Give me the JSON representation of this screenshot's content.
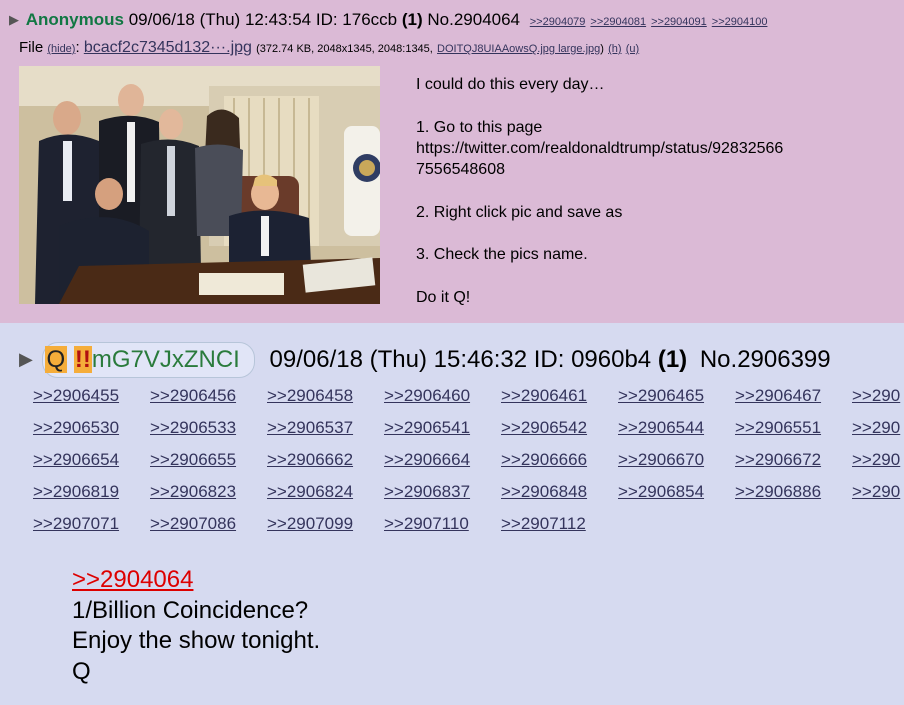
{
  "post1": {
    "name": "Anonymous",
    "datetime": "09/06/18 (Thu) 12:43:54",
    "id_label": "ID: 176ccb",
    "count": "(1)",
    "number": "No.2904064",
    "backlinks": [
      ">>2904079",
      ">>2904081",
      ">>2904091",
      ">>2904100"
    ],
    "file_label": "File",
    "hide_label": "(hide)",
    "filename": "bcacf2c7345d132···.jpg",
    "file_meta_open": "(372.74 KB, 2048x1345, 2048:1345,",
    "original_filename": "DOITQJ8UIAAowsQ.jpg large.jpg",
    "file_meta_close": ")",
    "h_label": "(h)",
    "u_label": "(u)",
    "message": {
      "line1": "I could do this every day…",
      "line2": "1. Go to this page",
      "line3": "https://twitter.com/realdonaldtrump/status/92832566",
      "line4": "7556548608",
      "line5": "2. Right click pic and save as",
      "line6": "3. Check the pics name.",
      "line7": "Do it Q!"
    }
  },
  "post2": {
    "name": "Q",
    "trip_mark": "!!",
    "tripcode": "mG7VJxZNCI",
    "datetime": "09/06/18 (Thu) 15:46:32",
    "id_label": "ID: 0960b4",
    "count": "(1)",
    "number": "No.2906399",
    "backlinks": [
      ">>2906455",
      ">>2906456",
      ">>2906458",
      ">>2906460",
      ">>2906461",
      ">>2906465",
      ">>2906467",
      ">>290",
      ">>2906530",
      ">>2906533",
      ">>2906537",
      ">>2906541",
      ">>2906542",
      ">>2906544",
      ">>2906551",
      ">>290",
      ">>2906654",
      ">>2906655",
      ">>2906662",
      ">>2906664",
      ">>2906666",
      ">>2906670",
      ">>2906672",
      ">>290",
      ">>2906819",
      ">>2906823",
      ">>2906824",
      ">>2906837",
      ">>2906848",
      ">>2906854",
      ">>2906886",
      ">>290",
      ">>2907071",
      ">>2907086",
      ">>2907099",
      ">>2907110",
      ">>2907112"
    ],
    "message": {
      "quote": ">>2904064",
      "line1": "1/Billion Coincidence?",
      "line2": "Enjoy the show tonight.",
      "line3": "Q"
    }
  },
  "colors": {
    "post1_bg": "#dbbad6",
    "post2_bg": "#d6daf0",
    "name_green": "#117743",
    "link": "#34345c",
    "quote_red": "#dd0000",
    "q_highlight": "#f5ad3a"
  }
}
